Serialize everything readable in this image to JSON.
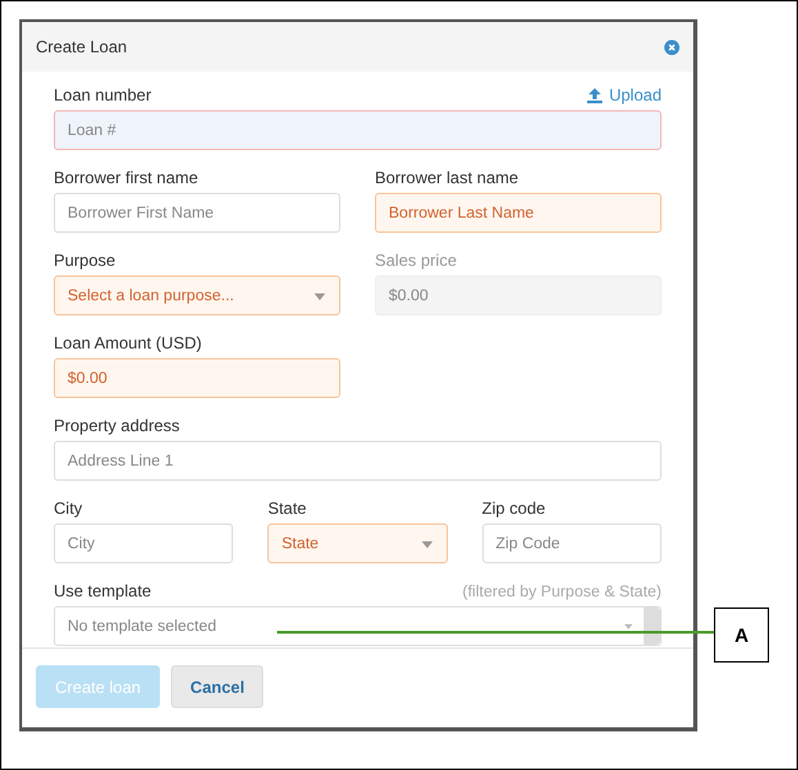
{
  "dialog": {
    "title": "Create Loan"
  },
  "rows": [
    {
      "kind": "full",
      "fields": [
        {
          "label": "Loan number",
          "action": "Upload",
          "kind": "text",
          "placeholder": "Loan #",
          "focused": true,
          "error": true
        }
      ]
    },
    {
      "kind": "pair",
      "fields": [
        {
          "label": "Borrower first name",
          "kind": "text",
          "placeholder": "Borrower First Name",
          "error": false
        },
        {
          "label": "Borrower last name",
          "kind": "text",
          "placeholder": "Borrower Last Name",
          "error": true
        }
      ]
    },
    {
      "kind": "pair",
      "fields": [
        {
          "label": "Purpose",
          "kind": "select",
          "placeholder": "Select a loan purpose...",
          "error": true
        },
        {
          "label": "Sales price",
          "kind": "text",
          "value": "$0.00",
          "disabled": true
        }
      ]
    },
    {
      "kind": "pair",
      "fields": [
        {
          "label": "Loan Amount (USD)",
          "kind": "text",
          "value": "$0.00",
          "error": true
        }
      ]
    },
    {
      "kind": "full",
      "fields": [
        {
          "label": "Property address",
          "kind": "text",
          "placeholder": "Address Line 1",
          "error": false
        }
      ]
    },
    {
      "kind": "triple",
      "fields": [
        {
          "label": "City",
          "kind": "text",
          "placeholder": "City",
          "error": false
        },
        {
          "label": "State",
          "kind": "select",
          "placeholder": "State",
          "error": true
        },
        {
          "label": "Zip code",
          "kind": "text",
          "placeholder": "Zip Code",
          "error": false
        }
      ]
    },
    {
      "kind": "full",
      "fields": [
        {
          "label": "Use template",
          "hint": "(filtered by Purpose & State)",
          "kind": "template",
          "value": "No template selected"
        }
      ]
    }
  ],
  "buttons": [
    {
      "label": "Create loan",
      "disabled": true,
      "primary": true
    },
    {
      "label": "Cancel",
      "disabled": false,
      "primary": false
    }
  ],
  "callout": {
    "label": "A"
  }
}
